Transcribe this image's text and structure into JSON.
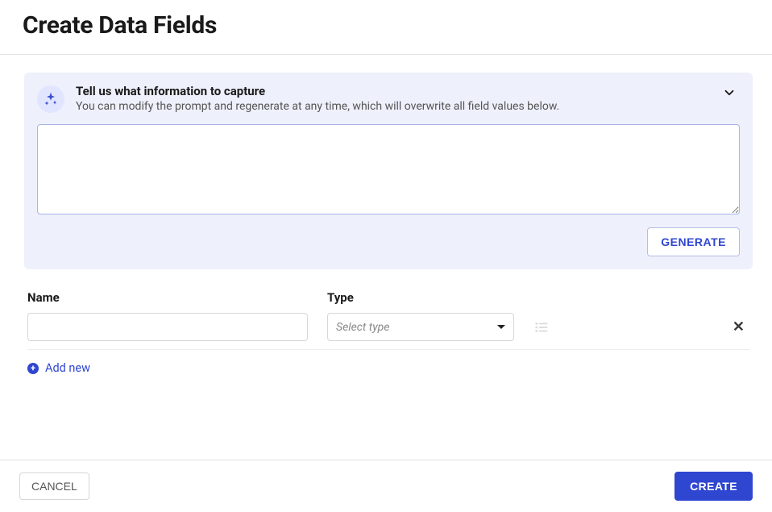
{
  "header": {
    "title": "Create Data Fields"
  },
  "prompt": {
    "title": "Tell us what information to capture",
    "subtitle": "You can modify the prompt and regenerate at any time, which will overwrite all field values below.",
    "textarea_value": "",
    "generate_label": "GENERATE"
  },
  "fields": {
    "name_header": "Name",
    "type_header": "Type",
    "rows": [
      {
        "name_value": "",
        "type_placeholder": "Select type"
      }
    ],
    "add_new_label": "Add new"
  },
  "footer": {
    "cancel_label": "CANCEL",
    "create_label": "CREATE"
  }
}
